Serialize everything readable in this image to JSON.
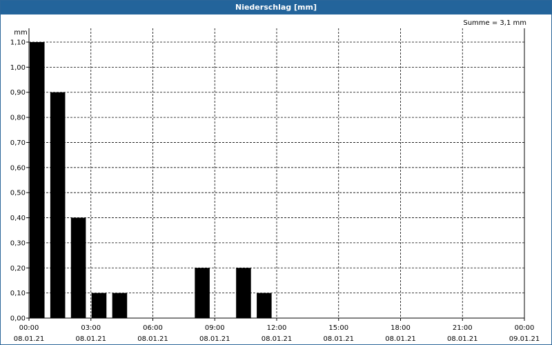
{
  "window": {
    "title": "Niederschlag [mm]",
    "summary": "Summe = 3,1 mm"
  },
  "chart_data": {
    "type": "bar",
    "title": "Niederschlag [mm]",
    "annotation": "Summe = 3,1 mm",
    "ylabel": "mm",
    "ylim": [
      0,
      1.1
    ],
    "yticks": [
      "0,00",
      "0,10",
      "0,20",
      "0,30",
      "0,40",
      "0,50",
      "0,60",
      "0,70",
      "0,80",
      "0,90",
      "1,00",
      "1,10"
    ],
    "xlim": [
      "08.01.21 00:00",
      "09.01.21 00:00"
    ],
    "xticks": [
      {
        "time": "00:00",
        "date": "08.01.21"
      },
      {
        "time": "03:00",
        "date": "08.01.21"
      },
      {
        "time": "06:00",
        "date": "08.01.21"
      },
      {
        "time": "09:00",
        "date": "08.01.21"
      },
      {
        "time": "12:00",
        "date": "08.01.21"
      },
      {
        "time": "15:00",
        "date": "08.01.21"
      },
      {
        "time": "18:00",
        "date": "08.01.21"
      },
      {
        "time": "21:00",
        "date": "08.01.21"
      },
      {
        "time": "00:00",
        "date": "09.01.21"
      }
    ],
    "grid": true,
    "bar_color": "#000000",
    "bars": [
      {
        "start": "00:00",
        "value": 1.1
      },
      {
        "start": "01:00",
        "value": 0.9
      },
      {
        "start": "02:00",
        "value": 0.4
      },
      {
        "start": "03:00",
        "value": 0.1
      },
      {
        "start": "04:00",
        "value": 0.1
      },
      {
        "start": "08:00",
        "value": 0.2
      },
      {
        "start": "10:00",
        "value": 0.2
      },
      {
        "start": "11:00",
        "value": 0.1
      }
    ]
  }
}
